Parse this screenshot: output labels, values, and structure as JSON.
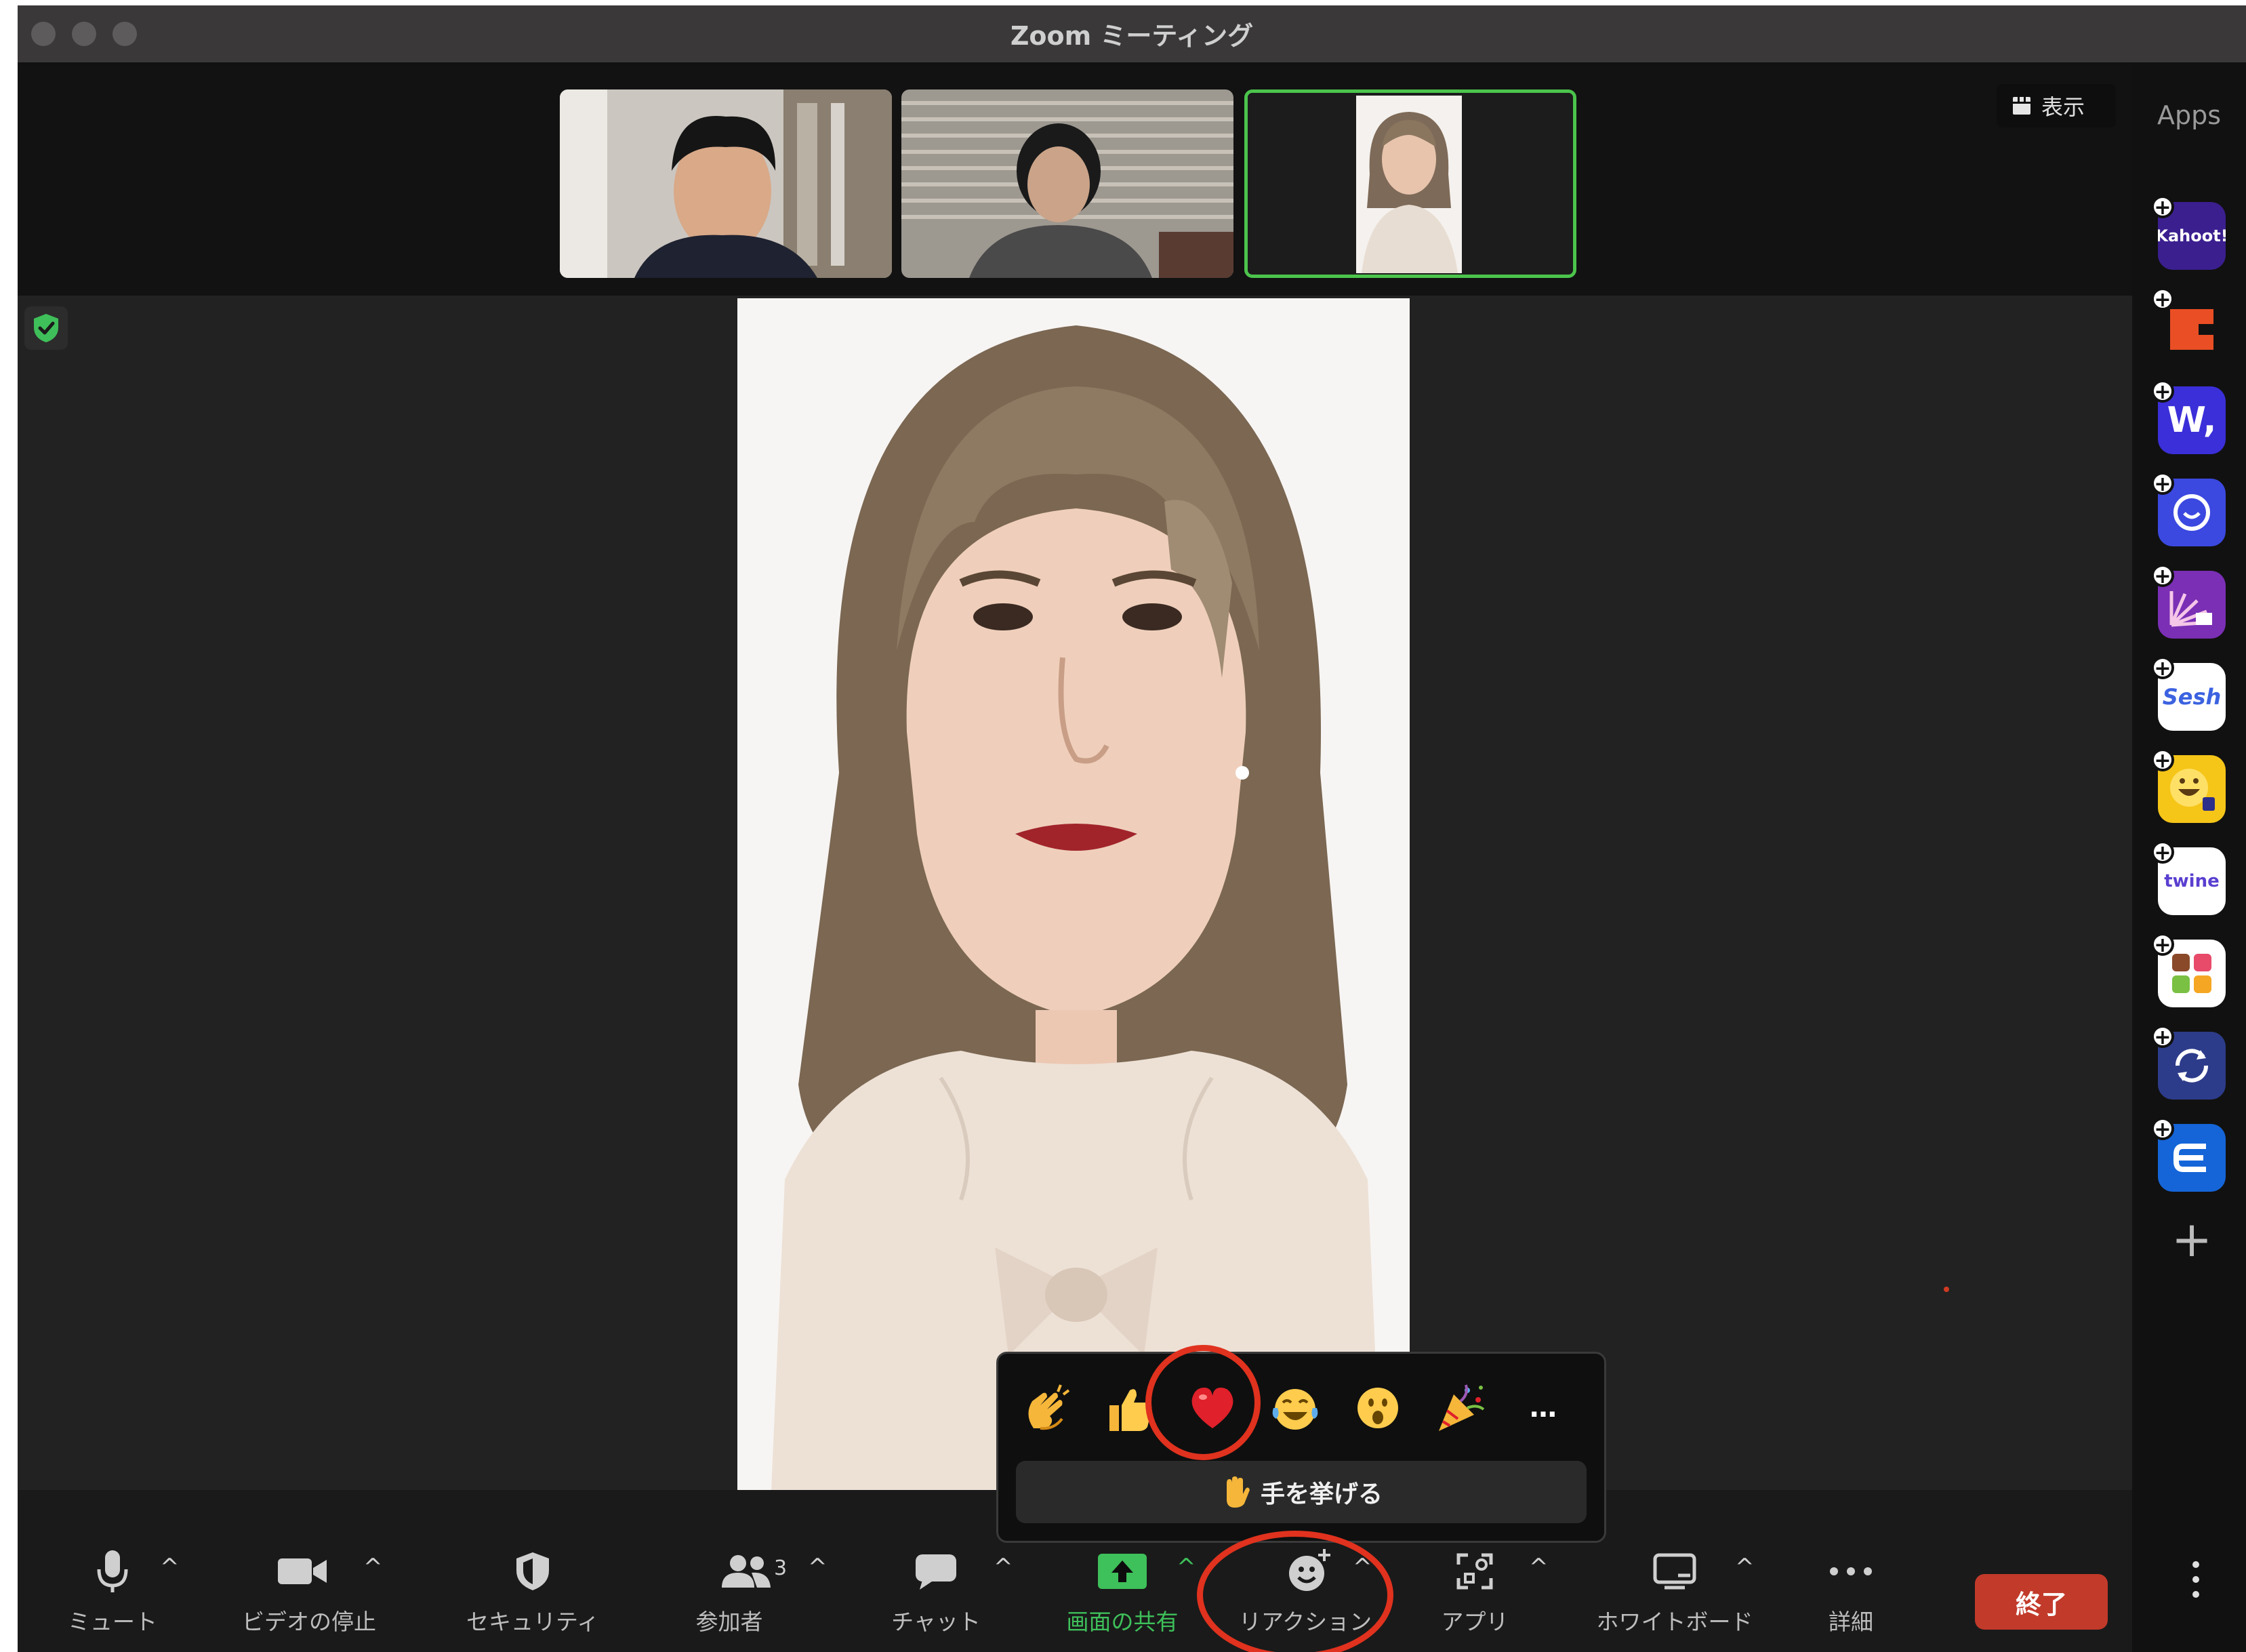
{
  "window": {
    "title": "Zoom ミーティング"
  },
  "strip": {
    "view_button_label": "表示"
  },
  "sidebar": {
    "apps_label": "Apps",
    "apps": [
      {
        "name": "kahoot",
        "label": "Kahoot!",
        "color": "#3b1f8f"
      },
      {
        "name": "app-2",
        "label": "",
        "color": "#ea4e25"
      },
      {
        "name": "app-w",
        "label": "W,",
        "color": "#3b2fd9"
      },
      {
        "name": "app-camera",
        "label": "",
        "color": "#3b49e0"
      },
      {
        "name": "app-sunburst",
        "label": "",
        "color": "#7a2fb5"
      },
      {
        "name": "sesh",
        "label": "Sesh",
        "color": "#ffffff"
      },
      {
        "name": "app-emoji",
        "label": "",
        "color": "#f5c518"
      },
      {
        "name": "twine",
        "label": "twine",
        "color": "#ffffff"
      },
      {
        "name": "app-blocks",
        "label": "",
        "color": "#ffffff"
      },
      {
        "name": "app-sync",
        "label": "",
        "color": "#2d3c8a"
      },
      {
        "name": "app-e",
        "label": "",
        "color": "#1565d8"
      }
    ]
  },
  "toolbar": {
    "mute": "ミュート",
    "video": "ビデオの停止",
    "security": "セキュリティ",
    "participants": "参加者",
    "participants_count": "3",
    "chat": "チャット",
    "share": "画面の共有",
    "reactions": "リアクション",
    "apps": "アプリ",
    "whiteboard": "ホワイトボード",
    "more": "詳細",
    "end": "終了"
  },
  "reactions_popup": {
    "emojis": [
      "clap",
      "thumbs-up",
      "heart",
      "joy",
      "open-mouth",
      "party-popper"
    ],
    "more": "…",
    "raise_hand": "手を挙げる"
  },
  "colors": {
    "accent_green": "#4cc44c",
    "end_red": "#c23a2a",
    "annotation_red": "#e0321e"
  }
}
